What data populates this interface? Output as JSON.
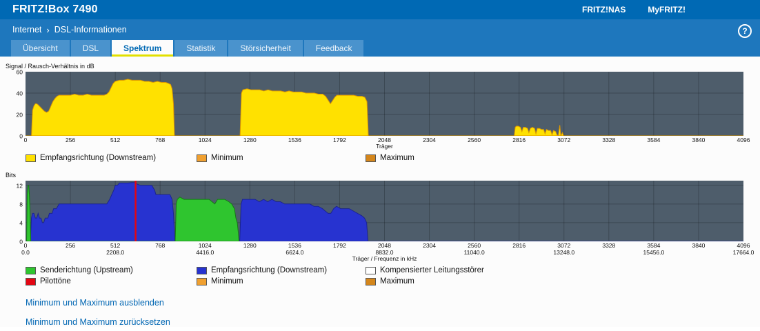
{
  "header": {
    "brand": "FRITZ!Box 7490",
    "links": [
      {
        "label": "FRITZ!NAS"
      },
      {
        "label": "MyFRITZ!"
      }
    ]
  },
  "breadcrumb": {
    "items": [
      "Internet",
      "DSL-Informationen"
    ],
    "separator": "›"
  },
  "help_label": "?",
  "tabs": [
    {
      "label": "Übersicht",
      "active": false
    },
    {
      "label": "DSL",
      "active": false
    },
    {
      "label": "Spektrum",
      "active": true
    },
    {
      "label": "Statistik",
      "active": false
    },
    {
      "label": "Störsicherheit",
      "active": false
    },
    {
      "label": "Feedback",
      "active": false
    }
  ],
  "chart_data": [
    {
      "type": "area",
      "title": "Signal / Rausch-Verhältnis in dB",
      "xlabel": "Träger",
      "xlim": [
        0,
        4096
      ],
      "ylim": [
        0,
        60
      ],
      "xticks": [
        0,
        256,
        512,
        768,
        1024,
        1280,
        1536,
        1792,
        2048,
        2304,
        2560,
        2816,
        3072,
        3328,
        3584,
        3840,
        4096
      ],
      "yticks": [
        0,
        20,
        40,
        60
      ],
      "background": "#4e5d6b",
      "legend_rows": [
        [
          {
            "label": "Empfangsrichtung (Downstream)",
            "color": "#ffe100"
          },
          {
            "label": "Minimum",
            "color": "#f0a030"
          },
          {
            "label": "Maximum",
            "color": "#d4861c"
          }
        ]
      ],
      "series": [
        {
          "name": "Empfangsrichtung (Downstream)",
          "color": "#ffe100",
          "stroke": "#dc9600",
          "points": [
            [
              0,
              0
            ],
            [
              34,
              0
            ],
            [
              40,
              24
            ],
            [
              48,
              28
            ],
            [
              56,
              30
            ],
            [
              64,
              30
            ],
            [
              72,
              29
            ],
            [
              84,
              27
            ],
            [
              96,
              25
            ],
            [
              108,
              23
            ],
            [
              120,
              22
            ],
            [
              132,
              23
            ],
            [
              140,
              26
            ],
            [
              148,
              29
            ],
            [
              156,
              32
            ],
            [
              168,
              35
            ],
            [
              180,
              37
            ],
            [
              192,
              38
            ],
            [
              216,
              38
            ],
            [
              240,
              38
            ],
            [
              256,
              38
            ],
            [
              280,
              39
            ],
            [
              304,
              38
            ],
            [
              328,
              38
            ],
            [
              352,
              39
            ],
            [
              376,
              38
            ],
            [
              400,
              38
            ],
            [
              424,
              38
            ],
            [
              448,
              38
            ],
            [
              464,
              39
            ],
            [
              476,
              41
            ],
            [
              488,
              45
            ],
            [
              500,
              49
            ],
            [
              512,
              51
            ],
            [
              536,
              52
            ],
            [
              560,
              52
            ],
            [
              584,
              53
            ],
            [
              608,
              52
            ],
            [
              632,
              52
            ],
            [
              656,
              52
            ],
            [
              680,
              51
            ],
            [
              704,
              51
            ],
            [
              728,
              50
            ],
            [
              752,
              51
            ],
            [
              776,
              50
            ],
            [
              800,
              50
            ],
            [
              816,
              49
            ],
            [
              828,
              48
            ],
            [
              836,
              44
            ],
            [
              844,
              30
            ],
            [
              850,
              0
            ],
            [
              1224,
              0
            ],
            [
              1232,
              40
            ],
            [
              1240,
              43
            ],
            [
              1264,
              44
            ],
            [
              1288,
              43
            ],
            [
              1312,
              43
            ],
            [
              1336,
              43
            ],
            [
              1360,
              42
            ],
            [
              1384,
              43
            ],
            [
              1408,
              42
            ],
            [
              1432,
              42
            ],
            [
              1456,
              42
            ],
            [
              1480,
              41
            ],
            [
              1504,
              42
            ],
            [
              1528,
              41
            ],
            [
              1552,
              41
            ],
            [
              1576,
              41
            ],
            [
              1600,
              40
            ],
            [
              1624,
              40
            ],
            [
              1648,
              40
            ],
            [
              1672,
              39
            ],
            [
              1696,
              39
            ],
            [
              1712,
              37
            ],
            [
              1728,
              33
            ],
            [
              1740,
              30
            ],
            [
              1752,
              33
            ],
            [
              1764,
              36
            ],
            [
              1776,
              38
            ],
            [
              1800,
              38
            ],
            [
              1824,
              38
            ],
            [
              1848,
              38
            ],
            [
              1872,
              38
            ],
            [
              1896,
              37
            ],
            [
              1920,
              37
            ],
            [
              1936,
              36
            ],
            [
              1948,
              32
            ],
            [
              1956,
              0
            ],
            [
              2788,
              0
            ],
            [
              2794,
              8
            ],
            [
              2800,
              9
            ],
            [
              2812,
              9
            ],
            [
              2824,
              8
            ],
            [
              2832,
              4
            ],
            [
              2840,
              8
            ],
            [
              2852,
              8
            ],
            [
              2864,
              7
            ],
            [
              2872,
              3
            ],
            [
              2880,
              7
            ],
            [
              2892,
              8
            ],
            [
              2904,
              7
            ],
            [
              2912,
              2
            ],
            [
              2920,
              7
            ],
            [
              2932,
              7
            ],
            [
              2944,
              6
            ],
            [
              2956,
              6
            ],
            [
              2964,
              2
            ],
            [
              2972,
              6
            ],
            [
              2984,
              5
            ],
            [
              2996,
              5
            ],
            [
              3004,
              1
            ],
            [
              3012,
              5
            ],
            [
              3024,
              4
            ],
            [
              3032,
              1
            ],
            [
              3040,
              0
            ],
            [
              3048,
              10
            ],
            [
              3054,
              0
            ],
            [
              3064,
              3
            ],
            [
              3070,
              0
            ],
            [
              4096,
              0
            ]
          ]
        }
      ]
    },
    {
      "type": "area",
      "title": "Bits",
      "xlabel": "Träger / Frequenz in kHz",
      "xlim": [
        0,
        4096
      ],
      "ylim": [
        0,
        13
      ],
      "xticks": [
        0,
        256,
        512,
        768,
        1024,
        1280,
        1536,
        1792,
        2048,
        2304,
        2560,
        2816,
        3072,
        3328,
        3584,
        3840,
        4096
      ],
      "xticks2": [
        [
          0,
          "0.0"
        ],
        [
          512,
          "2208.0"
        ],
        [
          1024,
          "4416.0"
        ],
        [
          1536,
          "6624.0"
        ],
        [
          2048,
          "8832.0"
        ],
        [
          2560,
          "11040.0"
        ],
        [
          3072,
          "13248.0"
        ],
        [
          3584,
          "15456.0"
        ],
        [
          4096,
          "17664.0"
        ]
      ],
      "yticks": [
        0,
        4,
        8,
        12
      ],
      "background": "#4e5d6b",
      "pilot_tones": [
        628
      ],
      "pilot_color": "#e30613",
      "legend_rows": [
        [
          {
            "label": "Senderichtung (Upstream)",
            "color": "#2fc52f"
          },
          {
            "label": "Empfangsrichtung (Downstream)",
            "color": "#2733d0"
          },
          {
            "label": "Kompensierter Leitungsstörer",
            "color": "#ffffff"
          }
        ],
        [
          {
            "label": "Pilottöne",
            "color": "#e30613"
          },
          {
            "label": "Minimum",
            "color": "#f0a030"
          },
          {
            "label": "Maximum",
            "color": "#d4861c"
          }
        ]
      ],
      "series": [
        {
          "name": "Empfangsrichtung (Downstream)",
          "color": "#2733d0",
          "stroke": "#1b2490",
          "points": [
            [
              28,
              0
            ],
            [
              34,
              5
            ],
            [
              40,
              6
            ],
            [
              48,
              6
            ],
            [
              56,
              5
            ],
            [
              64,
              5
            ],
            [
              72,
              6
            ],
            [
              80,
              5
            ],
            [
              88,
              5
            ],
            [
              96,
              4
            ],
            [
              104,
              4
            ],
            [
              112,
              5
            ],
            [
              120,
              5
            ],
            [
              128,
              5
            ],
            [
              136,
              6
            ],
            [
              144,
              6
            ],
            [
              152,
              6
            ],
            [
              160,
              7
            ],
            [
              176,
              7
            ],
            [
              192,
              8
            ],
            [
              208,
              8
            ],
            [
              224,
              8
            ],
            [
              240,
              8
            ],
            [
              256,
              8
            ],
            [
              288,
              8
            ],
            [
              320,
              8
            ],
            [
              352,
              8
            ],
            [
              384,
              8
            ],
            [
              416,
              8
            ],
            [
              448,
              8
            ],
            [
              464,
              8
            ],
            [
              480,
              9
            ],
            [
              492,
              10
            ],
            [
              504,
              11
            ],
            [
              512,
              12
            ],
            [
              524,
              12
            ],
            [
              536,
              12.5
            ],
            [
              560,
              12.5
            ],
            [
              584,
              12.5
            ],
            [
              608,
              12.6
            ],
            [
              624,
              12.6
            ],
            [
              640,
              12.2
            ],
            [
              656,
              12
            ],
            [
              672,
              12
            ],
            [
              688,
              12
            ],
            [
              704,
              12
            ],
            [
              720,
              12
            ],
            [
              736,
              11
            ],
            [
              744,
              10
            ],
            [
              760,
              10
            ],
            [
              776,
              10
            ],
            [
              792,
              10
            ],
            [
              808,
              10
            ],
            [
              824,
              10
            ],
            [
              836,
              9
            ],
            [
              844,
              6
            ],
            [
              852,
              0
            ],
            [
              1222,
              0
            ],
            [
              1230,
              8
            ],
            [
              1238,
              9
            ],
            [
              1262,
              9
            ],
            [
              1286,
              9
            ],
            [
              1310,
              9
            ],
            [
              1334,
              8.5
            ],
            [
              1358,
              9
            ],
            [
              1382,
              8.5
            ],
            [
              1406,
              9
            ],
            [
              1430,
              8.5
            ],
            [
              1454,
              8.5
            ],
            [
              1478,
              8
            ],
            [
              1502,
              8
            ],
            [
              1526,
              8
            ],
            [
              1550,
              8
            ],
            [
              1574,
              8
            ],
            [
              1598,
              8
            ],
            [
              1622,
              8
            ],
            [
              1646,
              7.5
            ],
            [
              1670,
              7.5
            ],
            [
              1694,
              7
            ],
            [
              1710,
              6.5
            ],
            [
              1726,
              6
            ],
            [
              1742,
              6
            ],
            [
              1758,
              7
            ],
            [
              1774,
              7.5
            ],
            [
              1798,
              7
            ],
            [
              1822,
              7
            ],
            [
              1846,
              7
            ],
            [
              1870,
              6.5
            ],
            [
              1894,
              6
            ],
            [
              1918,
              5.5
            ],
            [
              1934,
              5
            ],
            [
              1946,
              4
            ],
            [
              1954,
              0
            ],
            [
              4096,
              0
            ]
          ]
        },
        {
          "name": "Senderichtung (Upstream)",
          "color": "#2fc52f",
          "stroke": "#157a15",
          "points": [
            [
              6,
              0
            ],
            [
              10,
              10
            ],
            [
              14,
              12
            ],
            [
              18,
              12
            ],
            [
              22,
              10
            ],
            [
              26,
              6
            ],
            [
              30,
              0
            ],
            [
              854,
              0
            ],
            [
              860,
              8
            ],
            [
              866,
              9
            ],
            [
              880,
              9.5
            ],
            [
              904,
              9
            ],
            [
              928,
              9
            ],
            [
              952,
              9
            ],
            [
              976,
              9
            ],
            [
              1000,
              9
            ],
            [
              1024,
              9
            ],
            [
              1048,
              9
            ],
            [
              1064,
              8.5
            ],
            [
              1080,
              8
            ],
            [
              1096,
              9
            ],
            [
              1112,
              9
            ],
            [
              1136,
              9
            ],
            [
              1160,
              8.5
            ],
            [
              1176,
              8
            ],
            [
              1192,
              7
            ],
            [
              1200,
              5
            ],
            [
              1208,
              4
            ],
            [
              1214,
              2
            ],
            [
              1218,
              0
            ]
          ]
        }
      ]
    }
  ],
  "links": [
    {
      "label": "Minimum und Maximum ausblenden"
    },
    {
      "label": "Minimum und Maximum zurücksetzen"
    }
  ]
}
